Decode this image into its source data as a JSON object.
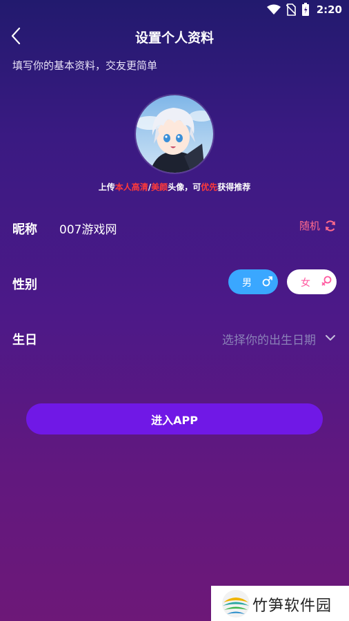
{
  "status": {
    "time": "2:20"
  },
  "header": {
    "title": "设置个人资料"
  },
  "subtitle": "填写你的基本资料，交友更简单",
  "avatar_hint": {
    "p1": "上传",
    "h1": "本人高清",
    "p2": "/",
    "h2": "美颜",
    "p3": "头像，可",
    "h3": "优先",
    "p4": "获得推荐"
  },
  "form": {
    "nickname_label": "昵称",
    "nickname_value": "007游戏网",
    "random_label": "随机",
    "gender_label": "性别",
    "male": "男",
    "female": "女",
    "birthday_label": "生日",
    "birthday_placeholder": "选择你的出生日期"
  },
  "enter_button": "进入APP",
  "watermark": "竹笋软件园",
  "colors": {
    "accent": "#7018e6",
    "male": "#3aa7ff",
    "female_text": "#ff5aa0",
    "highlight": "#ff3a3a"
  }
}
